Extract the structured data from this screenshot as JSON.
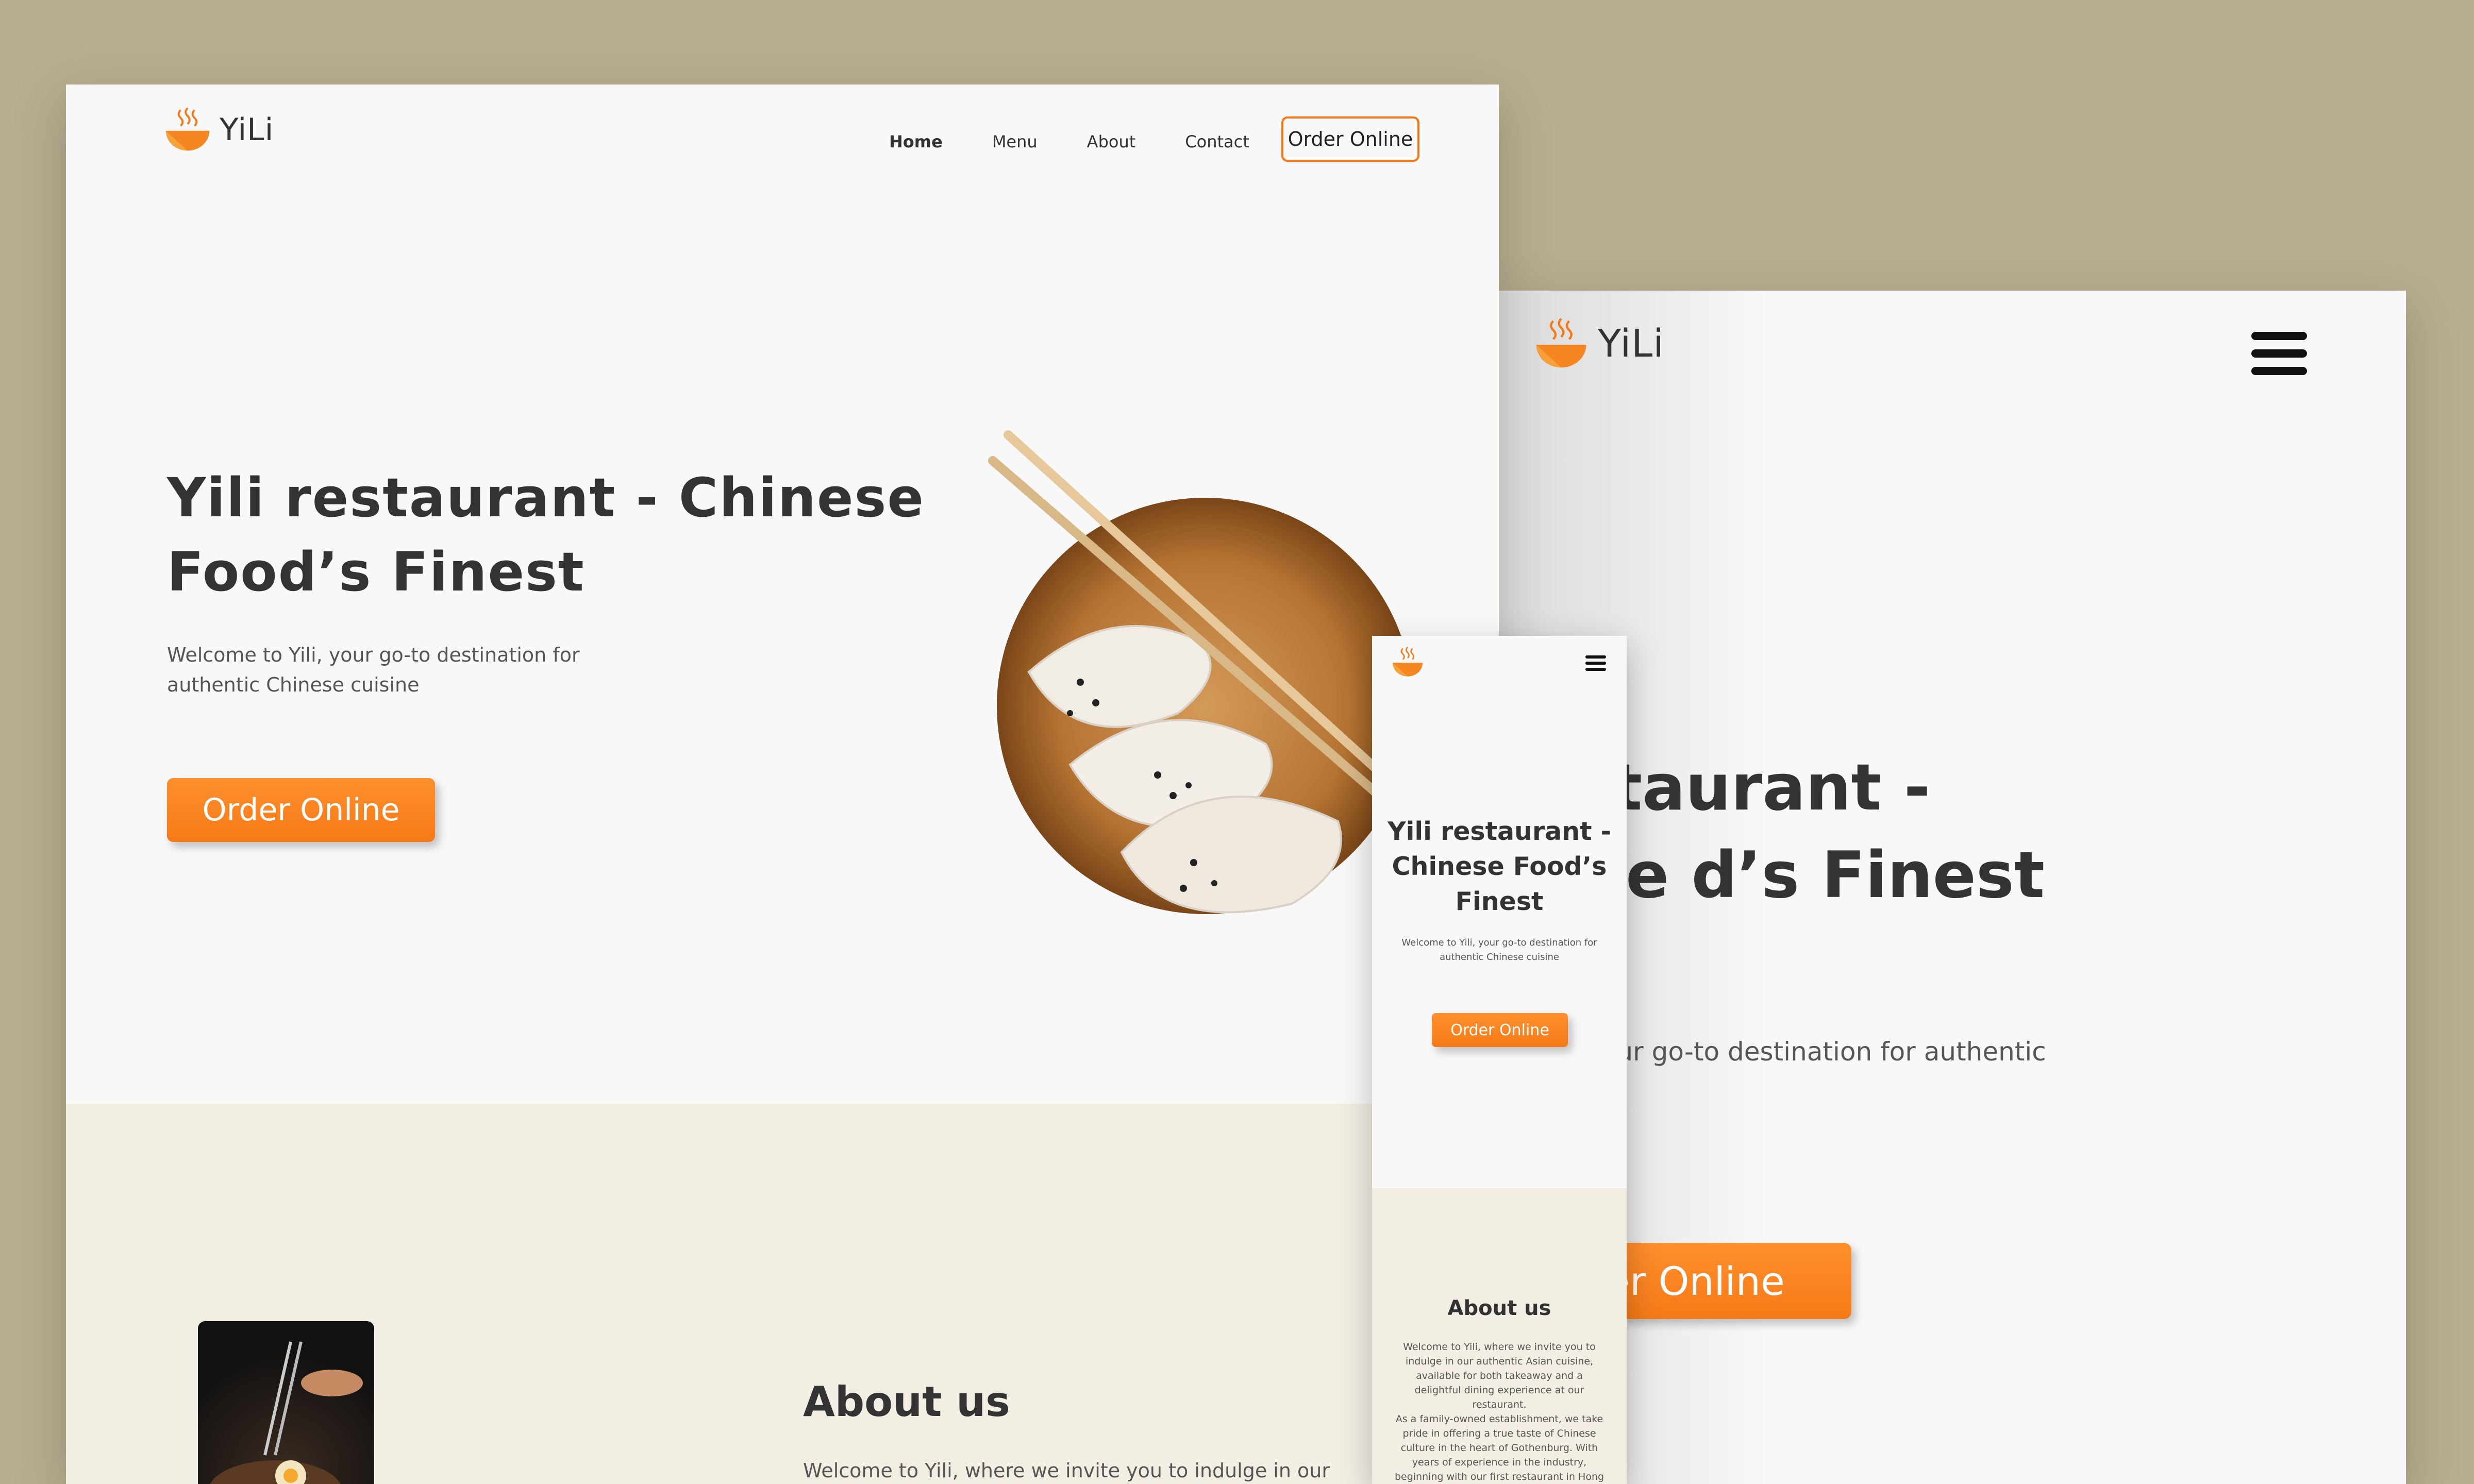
{
  "brand": {
    "name": "YiLi",
    "accent_color": "#f57a17",
    "background_color": "#b8ad91",
    "logo_icon": "steaming-bowl-icon"
  },
  "desktop": {
    "nav": {
      "items": [
        "Home",
        "Menu",
        "About",
        "Contact"
      ],
      "active": "Home",
      "order_button": "Order Online"
    },
    "hero": {
      "title": "Yili restaurant - Chinese Food’s Finest",
      "subtitle": "Welcome to Yili, your go-to destination for authentic Chinese cuisine",
      "cta": "Order Online",
      "image": "dumplings-plate-with-chopsticks"
    },
    "about": {
      "title": "About us",
      "text": "Welcome to Yili, where we invite you to indulge in our"
    }
  },
  "tablet": {
    "menu_icon": "hamburger-menu-icon",
    "hero": {
      "title": "restaurant - nese d’s Finest",
      "subtitle": "to Yili, your go-to destination for authentic Chinese",
      "cta": "rder Online"
    }
  },
  "mobile": {
    "menu_icon": "hamburger-menu-icon",
    "hero": {
      "title": "Yili restaurant - Chinese Food’s Finest",
      "subtitle": "Welcome to Yili, your go-to destination for authentic Chinese cuisine",
      "cta": "Order Online"
    },
    "about": {
      "title": "About us",
      "p1": "Welcome to Yili, where we invite you to indulge in our authentic Asian cuisine, available for both takeaway and a delightful dining experience at our restaurant.",
      "p2": "As a family-owned establishment, we take pride in offering a true taste of Chinese culture in the heart of Gothenburg. With years of experience in the industry, beginning with our first restaurant in Hong"
    }
  }
}
